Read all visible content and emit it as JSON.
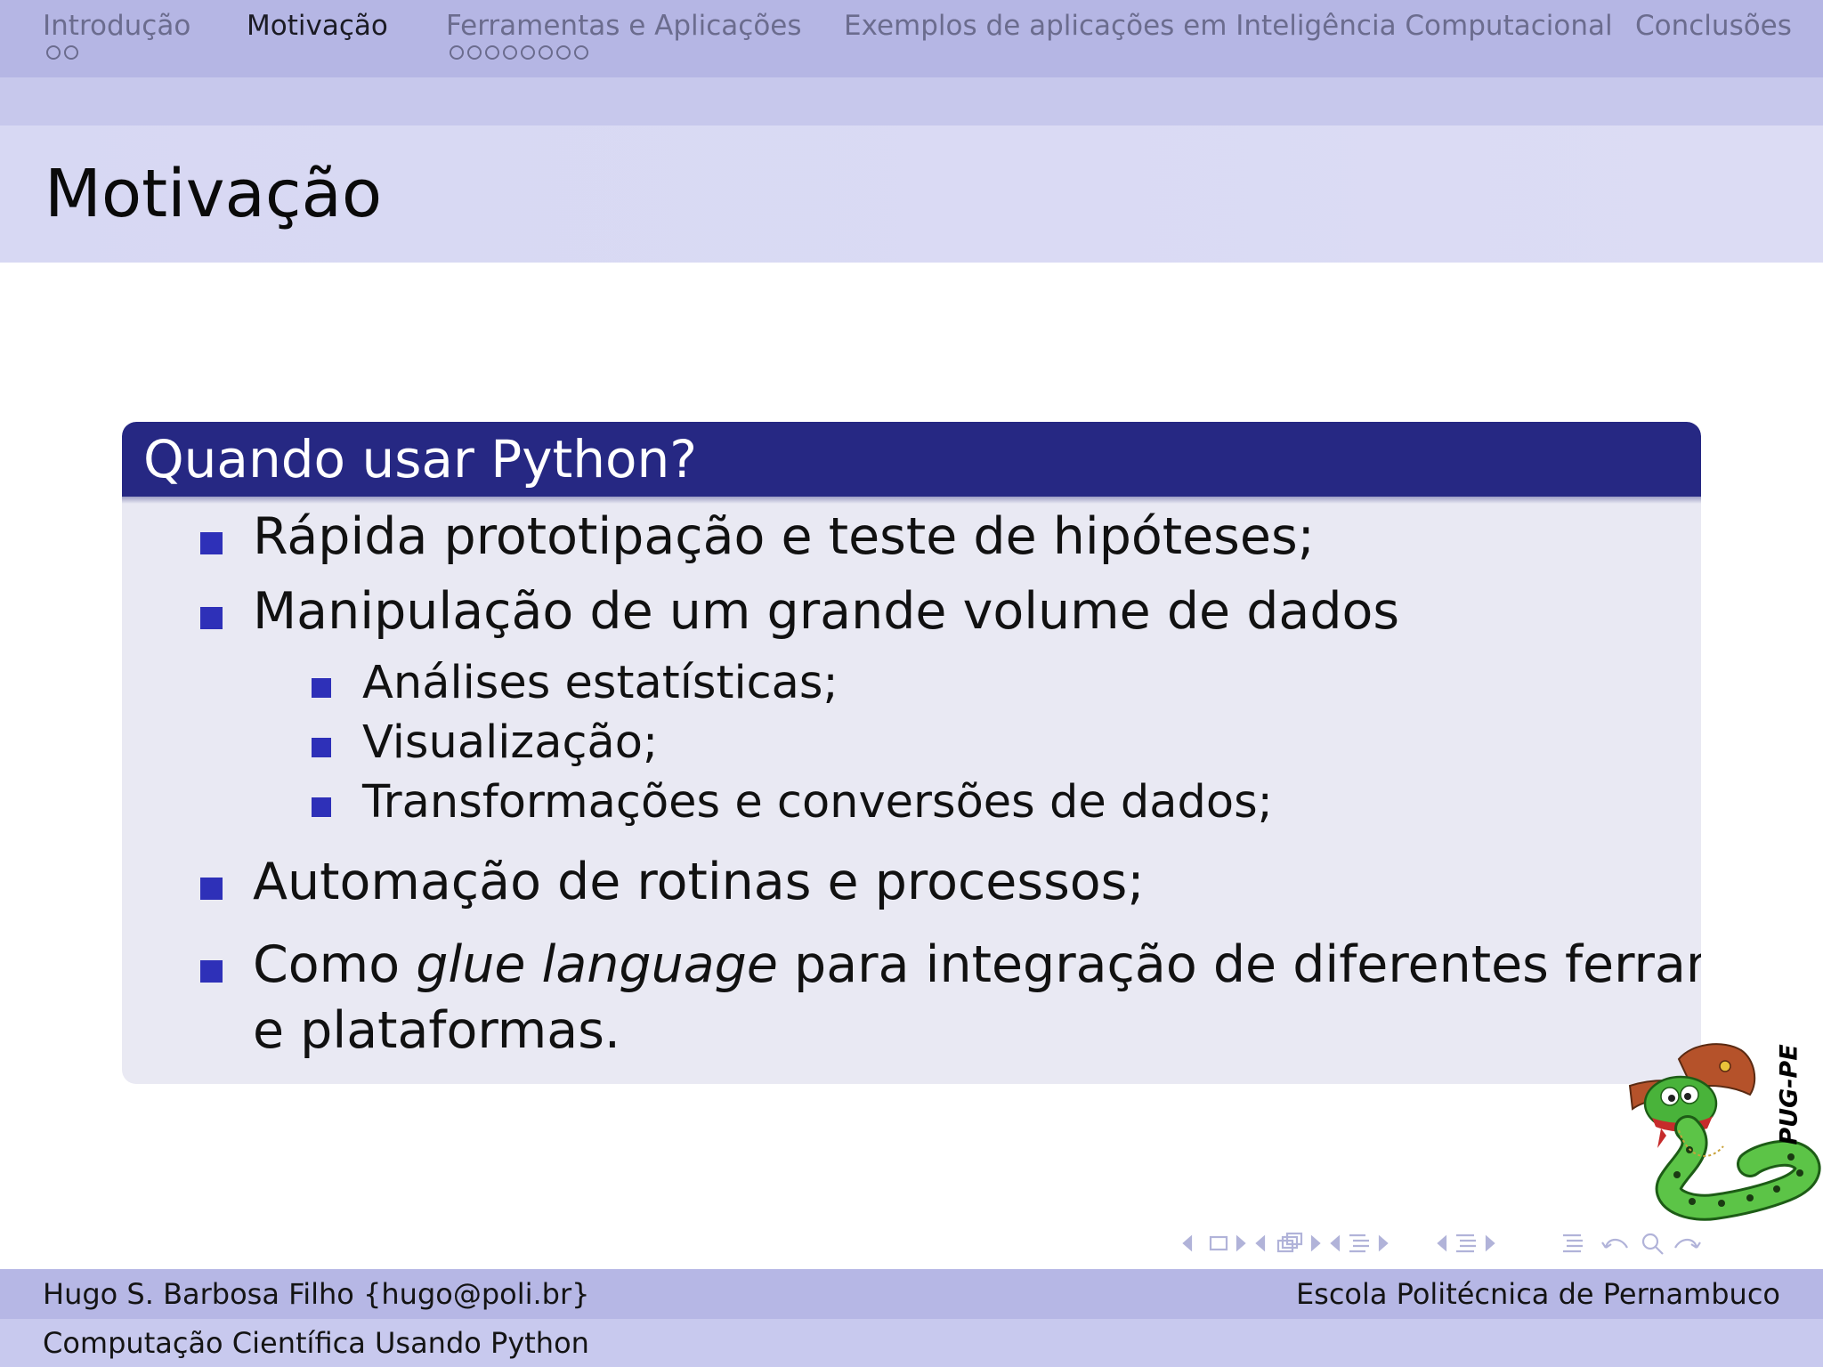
{
  "nav": {
    "sections": [
      {
        "label": "Introdução",
        "dots": 2,
        "active": false
      },
      {
        "label": "Motivação",
        "dots": 0,
        "active": true
      },
      {
        "label": "Ferramentas e Aplicações",
        "dots": 8,
        "active": false
      },
      {
        "label": "Exemplos de aplicações em Inteligência Computacional",
        "dots": 0,
        "active": false
      },
      {
        "label": "Conclusões",
        "dots": 0,
        "active": false
      }
    ]
  },
  "frame": {
    "title": "Motivação"
  },
  "block": {
    "title": "Quando usar Python?",
    "items": [
      "Rápida prototipação e teste de hipóteses;",
      "Manipulação de um grande volume de dados",
      "Análises estatísticas;",
      "Visualização;",
      "Transformações e conversões de dados;",
      "Automação de rotinas e processos;"
    ],
    "last_item": {
      "prefix": "Como ",
      "emphasis": "glue language",
      "suffix": " para integração de diferentes ferramentas",
      "continuation": "e plataformas."
    }
  },
  "logo": {
    "text": "PUG-PE"
  },
  "footer": {
    "author": "Hugo S. Barbosa Filho {hugo@poli.br}",
    "institution": "Escola Politécnica de Pernambuco",
    "talk_title": "Computação Científica Usando Python"
  },
  "colors": {
    "nav_bg": "#b5b6e4",
    "block_header": "#262883",
    "block_body": "#e9e9f3",
    "bullet": "#2e30b8"
  }
}
